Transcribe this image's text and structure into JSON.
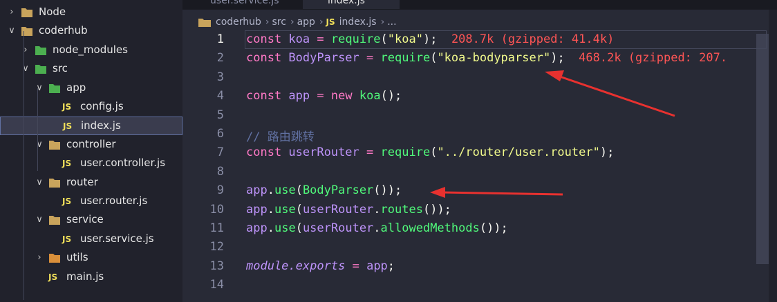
{
  "sidebar": {
    "items": [
      {
        "label": "Node",
        "type": "folder",
        "expanded": false
      },
      {
        "label": "coderhub",
        "type": "folder",
        "expanded": true
      },
      {
        "label": "node_modules",
        "type": "folder",
        "expanded": false
      },
      {
        "label": "src",
        "type": "folder",
        "expanded": true
      },
      {
        "label": "app",
        "type": "folder",
        "expanded": true
      },
      {
        "label": "config.js",
        "type": "js"
      },
      {
        "label": "index.js",
        "type": "js",
        "selected": true
      },
      {
        "label": "controller",
        "type": "folder",
        "expanded": true
      },
      {
        "label": "user.controller.js",
        "type": "js"
      },
      {
        "label": "router",
        "type": "folder",
        "expanded": true
      },
      {
        "label": "user.router.js",
        "type": "js"
      },
      {
        "label": "service",
        "type": "folder",
        "expanded": true
      },
      {
        "label": "user.service.js",
        "type": "js"
      },
      {
        "label": "utils",
        "type": "folder",
        "expanded": false
      },
      {
        "label": "main.js",
        "type": "js"
      }
    ],
    "js_badge": "JS"
  },
  "tabs": [
    {
      "label": "user.service.js"
    },
    {
      "label": "index.js",
      "active": true
    }
  ],
  "breadcrumb": {
    "parts": [
      "coderhub",
      "src",
      "app"
    ],
    "file": "index.js",
    "tail": "...",
    "sep": "›",
    "js_badge": "JS"
  },
  "lines": [
    {
      "n": "1",
      "active": true,
      "tokens": [
        [
          "kw",
          "const"
        ],
        [
          "",
          ""
        ],
        [
          "id",
          "koa"
        ],
        [
          "",
          " "
        ],
        [
          "kw",
          "="
        ],
        [
          "",
          " "
        ],
        [
          "fn",
          "require"
        ],
        [
          "",
          "("
        ],
        [
          "str",
          "\"koa\""
        ],
        [
          "",
          ");"
        ]
      ],
      "size": "208.7k (gzipped: 41.4k)"
    },
    {
      "n": "2",
      "tokens": [
        [
          "kw",
          "const"
        ],
        [
          "id",
          "BodyParser"
        ],
        [
          "",
          " "
        ],
        [
          "kw",
          "="
        ],
        [
          "",
          " "
        ],
        [
          "fn",
          "require"
        ],
        [
          "",
          "("
        ],
        [
          "str",
          "\"koa-bodyparser\""
        ],
        [
          "",
          ");"
        ]
      ],
      "size": "468.2k (gzipped: 207."
    },
    {
      "n": "3",
      "tokens": []
    },
    {
      "n": "4",
      "tokens": [
        [
          "kw",
          "const"
        ],
        [
          "id",
          "app"
        ],
        [
          "",
          " "
        ],
        [
          "kw",
          "="
        ],
        [
          "",
          " "
        ],
        [
          "kw",
          "new"
        ],
        [
          "",
          " "
        ],
        [
          "fn",
          "koa"
        ],
        [
          "",
          "();"
        ]
      ]
    },
    {
      "n": "5",
      "tokens": []
    },
    {
      "n": "6",
      "tokens": [
        [
          "cmt",
          "// 路由跳转"
        ]
      ]
    },
    {
      "n": "7",
      "tokens": [
        [
          "kw",
          "const"
        ],
        [
          "id",
          "userRouter"
        ],
        [
          "",
          " "
        ],
        [
          "kw",
          "="
        ],
        [
          "",
          " "
        ],
        [
          "fn",
          "require"
        ],
        [
          "",
          "("
        ],
        [
          "str",
          "\"../router/user.router\""
        ],
        [
          "",
          ");"
        ]
      ]
    },
    {
      "n": "8",
      "tokens": []
    },
    {
      "n": "9",
      "tokens": [
        [
          "id",
          "app"
        ],
        [
          "",
          "."
        ],
        [
          "fn",
          "use"
        ],
        [
          "",
          "("
        ],
        [
          "fn",
          "BodyParser"
        ],
        [
          "",
          "());"
        ]
      ]
    },
    {
      "n": "10",
      "tokens": [
        [
          "id",
          "app"
        ],
        [
          "",
          "."
        ],
        [
          "fn",
          "use"
        ],
        [
          "",
          "("
        ],
        [
          "id",
          "userRouter"
        ],
        [
          "",
          "."
        ],
        [
          "fn",
          "routes"
        ],
        [
          "",
          "());"
        ]
      ]
    },
    {
      "n": "11",
      "tokens": [
        [
          "id",
          "app"
        ],
        [
          "",
          "."
        ],
        [
          "fn",
          "use"
        ],
        [
          "",
          "("
        ],
        [
          "id",
          "userRouter"
        ],
        [
          "",
          "."
        ],
        [
          "fn",
          "allowedMethods"
        ],
        [
          "",
          "());"
        ]
      ]
    },
    {
      "n": "12",
      "tokens": []
    },
    {
      "n": "13",
      "tokens": [
        [
          "ital",
          "module"
        ],
        [
          "ital",
          "."
        ],
        [
          "ital",
          "exports"
        ],
        [
          "",
          " "
        ],
        [
          "kw",
          "="
        ],
        [
          "",
          " "
        ],
        [
          "id",
          "app"
        ],
        [
          "",
          ";"
        ]
      ]
    },
    {
      "n": "14",
      "tokens": []
    }
  ],
  "colors": {
    "annotation_arrow": "#e8312f",
    "keyword": "#ff79c6",
    "function": "#50fa7b",
    "string": "#f1fa8c",
    "variable": "#bd93f9",
    "size_hint": "#ff5555"
  }
}
